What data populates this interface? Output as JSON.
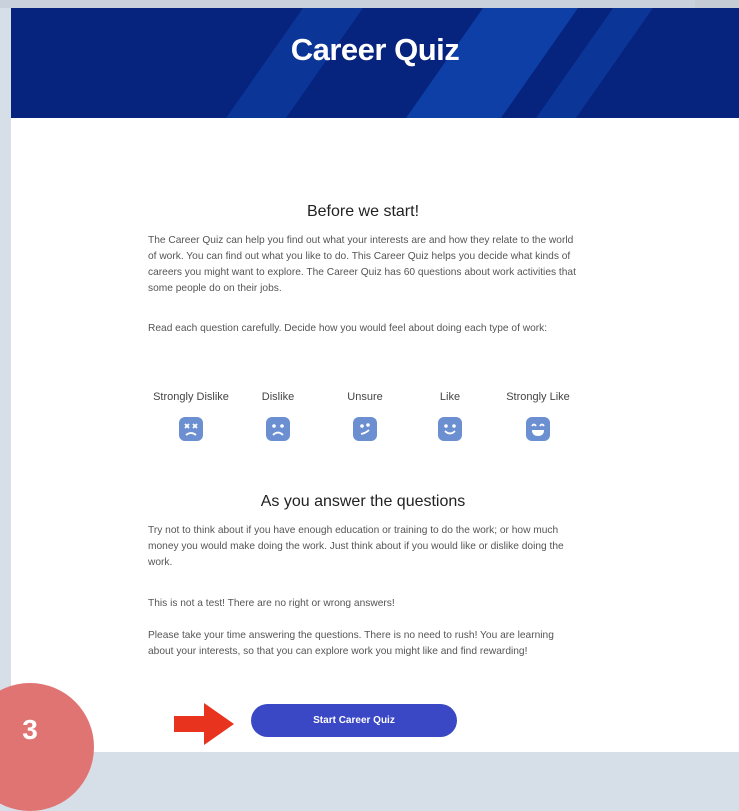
{
  "header": {
    "title": "Career Quiz"
  },
  "intro": {
    "heading": "Before we start!",
    "p1": "The Career Quiz can help you find out what your interests are and how they relate to the world of work. You can find out what you like to do. This Career Quiz helps you decide what kinds of careers you might want to explore. The Career Quiz has 60 questions about work activities that some people do on their jobs.",
    "p2": "Read each question carefully. Decide how you would feel about doing each type of work:"
  },
  "scale": [
    {
      "label": "Strongly Dislike",
      "icon": "strongly-dislike-face-icon"
    },
    {
      "label": "Dislike",
      "icon": "dislike-face-icon"
    },
    {
      "label": "Unsure",
      "icon": "unsure-face-icon"
    },
    {
      "label": "Like",
      "icon": "like-face-icon"
    },
    {
      "label": "Strongly Like",
      "icon": "strongly-like-face-icon"
    }
  ],
  "answering": {
    "heading": "As you answer the questions",
    "p1": "Try not to think about if you have enough education or training to do the work; or how much money you would make doing the work. Just think about if you would like or dislike doing the work.",
    "p2": "This is not a test! There are no right or wrong answers!",
    "p3": "Please take your time answering the questions. There is no need to rush! You are learning about your interests, so that you can explore work you might like and find rewarding!"
  },
  "start_button": "Start Career Quiz",
  "step_badge": "3",
  "colors": {
    "header": "#06237d",
    "button": "#3a48c5",
    "face": "#6b8fd0",
    "badge": "#e07473",
    "arrow": "#e8331f"
  }
}
